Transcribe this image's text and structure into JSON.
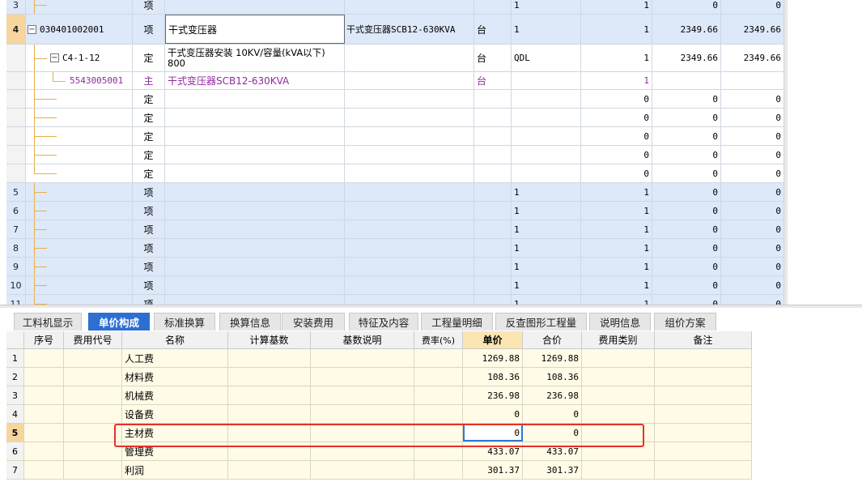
{
  "top_grid": {
    "rows": [
      {
        "rn": "3",
        "code": "",
        "type": "项",
        "name": "",
        "feature": "",
        "unit": "",
        "qexp": "1",
        "qty": "1",
        "unit_price": "0",
        "total": "0",
        "style": "blue"
      },
      {
        "rn": "4",
        "code": "030401002001",
        "type": "项",
        "name": "干式变压器",
        "feature": "干式变压器SCB12-630KVA",
        "unit": "台",
        "qexp": "1",
        "qty": "1",
        "unit_price": "2349.66",
        "total": "2349.66",
        "style": "blue-sel"
      },
      {
        "rn": "",
        "code": "C4-1-12",
        "type": "定",
        "name": "干式变压器安装 10KV/容量(kVA以下) 800",
        "feature": "",
        "unit": "台",
        "qexp": "QDL",
        "qty": "1",
        "unit_price": "2349.66",
        "total": "2349.66",
        "style": "white"
      },
      {
        "rn": "",
        "code": "5543005001",
        "type": "主",
        "name": "干式变压器SCB12-630KVA",
        "feature": "",
        "unit": "台",
        "qexp": "",
        "qty": "1",
        "unit_price": "",
        "total": "",
        "style": "white-purple"
      },
      {
        "rn": "",
        "code": "",
        "type": "定",
        "name": "",
        "feature": "",
        "unit": "",
        "qexp": "",
        "qty": "0",
        "unit_price": "0",
        "total": "0",
        "style": "white"
      },
      {
        "rn": "",
        "code": "",
        "type": "定",
        "name": "",
        "feature": "",
        "unit": "",
        "qexp": "",
        "qty": "0",
        "unit_price": "0",
        "total": "0",
        "style": "white"
      },
      {
        "rn": "",
        "code": "",
        "type": "定",
        "name": "",
        "feature": "",
        "unit": "",
        "qexp": "",
        "qty": "0",
        "unit_price": "0",
        "total": "0",
        "style": "white"
      },
      {
        "rn": "",
        "code": "",
        "type": "定",
        "name": "",
        "feature": "",
        "unit": "",
        "qexp": "",
        "qty": "0",
        "unit_price": "0",
        "total": "0",
        "style": "white"
      },
      {
        "rn": "",
        "code": "",
        "type": "定",
        "name": "",
        "feature": "",
        "unit": "",
        "qexp": "",
        "qty": "0",
        "unit_price": "0",
        "total": "0",
        "style": "white"
      },
      {
        "rn": "5",
        "code": "",
        "type": "项",
        "name": "",
        "feature": "",
        "unit": "",
        "qexp": "1",
        "qty": "1",
        "unit_price": "0",
        "total": "0",
        "style": "blue"
      },
      {
        "rn": "6",
        "code": "",
        "type": "项",
        "name": "",
        "feature": "",
        "unit": "",
        "qexp": "1",
        "qty": "1",
        "unit_price": "0",
        "total": "0",
        "style": "blue"
      },
      {
        "rn": "7",
        "code": "",
        "type": "项",
        "name": "",
        "feature": "",
        "unit": "",
        "qexp": "1",
        "qty": "1",
        "unit_price": "0",
        "total": "0",
        "style": "blue"
      },
      {
        "rn": "8",
        "code": "",
        "type": "项",
        "name": "",
        "feature": "",
        "unit": "",
        "qexp": "1",
        "qty": "1",
        "unit_price": "0",
        "total": "0",
        "style": "blue"
      },
      {
        "rn": "9",
        "code": "",
        "type": "项",
        "name": "",
        "feature": "",
        "unit": "",
        "qexp": "1",
        "qty": "1",
        "unit_price": "0",
        "total": "0",
        "style": "blue"
      },
      {
        "rn": "10",
        "code": "",
        "type": "项",
        "name": "",
        "feature": "",
        "unit": "",
        "qexp": "1",
        "qty": "1",
        "unit_price": "0",
        "total": "0",
        "style": "blue"
      },
      {
        "rn": "11",
        "code": "",
        "type": "项",
        "name": "",
        "feature": "",
        "unit": "",
        "qexp": "1",
        "qty": "1",
        "unit_price": "0",
        "total": "0",
        "style": "blue"
      }
    ]
  },
  "tabs": [
    {
      "label": "工料机显示",
      "active": false
    },
    {
      "label": "单价构成",
      "active": true
    },
    {
      "label": "标准换算",
      "active": false
    },
    {
      "label": "换算信息",
      "active": false
    },
    {
      "label": "安装费用",
      "active": false
    },
    {
      "label": "特征及内容",
      "active": false
    },
    {
      "label": "工程量明细",
      "active": false
    },
    {
      "label": "反查图形工程量",
      "active": false
    },
    {
      "label": "说明信息",
      "active": false
    },
    {
      "label": "组价方案",
      "active": false
    }
  ],
  "price_table": {
    "headers": {
      "seq": "序号",
      "code": "费用代号",
      "name": "名称",
      "base": "计算基数",
      "desc": "基数说明",
      "rate": "费率(%)",
      "unit_price": "单价",
      "total": "合价",
      "category": "费用类别",
      "remark": "备注"
    },
    "rows": [
      {
        "rn": "1",
        "name": "人工费",
        "unit_price": "1269.88",
        "total": "1269.88"
      },
      {
        "rn": "2",
        "name": "材料费",
        "unit_price": "108.36",
        "total": "108.36"
      },
      {
        "rn": "3",
        "name": "机械费",
        "unit_price": "236.98",
        "total": "236.98"
      },
      {
        "rn": "4",
        "name": "设备费",
        "unit_price": "0",
        "total": "0"
      },
      {
        "rn": "5",
        "name": "主材费",
        "unit_price": "0",
        "total": "0",
        "selected": true
      },
      {
        "rn": "6",
        "name": "管理费",
        "unit_price": "433.07",
        "total": "433.07"
      },
      {
        "rn": "7",
        "name": "利润",
        "unit_price": "301.37",
        "total": "301.37"
      }
    ]
  },
  "colors": {
    "row_blue": "#dde8f8",
    "tab_active": "#2c6fd1",
    "highlight_border": "#e8302a",
    "main_material_text": "#8e2c9e"
  }
}
